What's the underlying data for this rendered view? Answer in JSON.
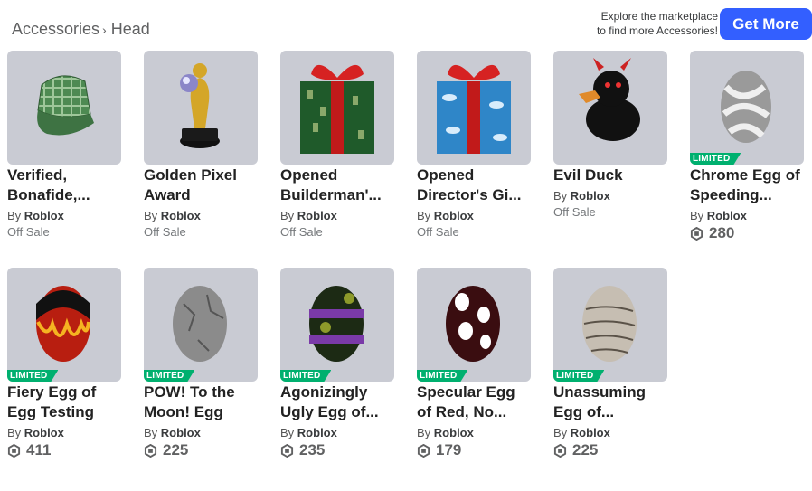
{
  "breadcrumb": {
    "parent": "Accessories",
    "separator": "›",
    "current": "Head"
  },
  "explore": {
    "line1": "Explore the marketplace",
    "line2": "to find more Accessories!"
  },
  "get_more_label": "Get More",
  "colors": {
    "accent": "#335fff",
    "limited": "#00b06f",
    "thumb_bg": "#c9cbd3"
  },
  "items": [
    {
      "name": "Verified, Bonafide,...",
      "by": "By",
      "creator": "Roblox",
      "status": "Off Sale",
      "limited": "",
      "price": "",
      "icon": "green-plaid-cap"
    },
    {
      "name": "Golden Pixel Award",
      "by": "By",
      "creator": "Roblox",
      "status": "Off Sale",
      "limited": "",
      "price": "",
      "icon": "golden-trophy"
    },
    {
      "name": "Opened Builderman'...",
      "by": "By",
      "creator": "Roblox",
      "status": "Off Sale",
      "limited": "",
      "price": "",
      "icon": "green-gift-box"
    },
    {
      "name": "Opened Director's Gi...",
      "by": "By",
      "creator": "Roblox",
      "status": "Off Sale",
      "limited": "",
      "price": "",
      "icon": "blue-gift-box"
    },
    {
      "name": "Evil Duck",
      "by": "By",
      "creator": "Roblox",
      "status": "Off Sale",
      "limited": "",
      "price": "",
      "icon": "evil-duck"
    },
    {
      "name": "Chrome Egg of Speeding...",
      "by": "By",
      "creator": "Roblox",
      "status": "",
      "limited": "LIMITED",
      "price": "280",
      "icon": "chrome-egg"
    },
    {
      "name": "Fiery Egg of Egg Testing",
      "by": "By",
      "creator": "Roblox",
      "status": "",
      "limited": "LIMITED",
      "price": "411",
      "icon": "fiery-egg"
    },
    {
      "name": "POW! To the Moon! Egg",
      "by": "By",
      "creator": "Roblox",
      "status": "",
      "limited": "LIMITED",
      "price": "225",
      "icon": "moon-egg"
    },
    {
      "name": "Agonizingly Ugly Egg of...",
      "by": "By",
      "creator": "Roblox",
      "status": "",
      "limited": "LIMITED",
      "price": "235",
      "icon": "ugly-egg"
    },
    {
      "name": "Specular Egg of Red, No...",
      "by": "By",
      "creator": "Roblox",
      "status": "",
      "limited": "LIMITED",
      "price": "179",
      "icon": "specular-egg"
    },
    {
      "name": "Unassuming Egg of...",
      "by": "By",
      "creator": "Roblox",
      "status": "",
      "limited": "LIMITED",
      "price": "225",
      "icon": "unassuming-egg"
    }
  ]
}
